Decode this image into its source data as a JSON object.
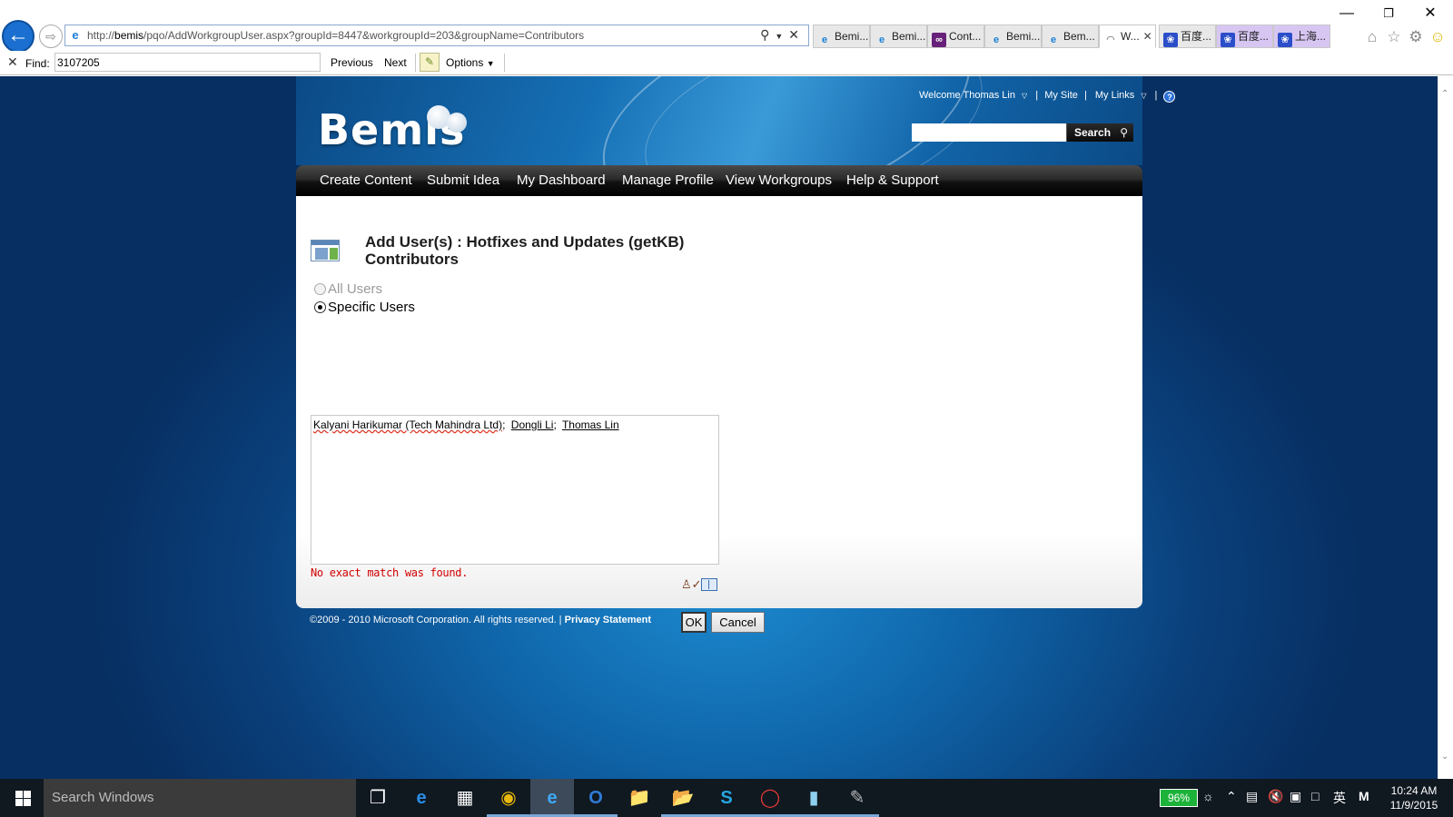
{
  "browser": {
    "url_prefix": "http://",
    "url_host": "bemis",
    "url_path": "/pqo/AddWorkgroupUser.aspx?groupId=8447&workgroupId=203&groupName=Contributors",
    "tabs": [
      {
        "label": "Bemi...",
        "icon": "ie-icon"
      },
      {
        "label": "Bemi...",
        "icon": "ie-icon"
      },
      {
        "label": "Cont...",
        "icon": "visual-studio-icon"
      },
      {
        "label": "Bemi...",
        "icon": "ie-icon"
      },
      {
        "label": "Bem...",
        "icon": "ie-icon"
      },
      {
        "label": "W...",
        "icon": "loading-icon",
        "active": true
      },
      {
        "label": "百度...",
        "icon": "baidu-icon"
      },
      {
        "label": "百度...",
        "icon": "baidu-icon"
      },
      {
        "label": "上海...",
        "icon": "baidu-icon"
      }
    ],
    "find": {
      "label": "Find:",
      "value": "3107205",
      "previous": "Previous",
      "next": "Next",
      "options": "Options"
    }
  },
  "site": {
    "logo": "Bemis",
    "welcome": "Welcome Thomas Lin",
    "my_site": "My Site",
    "my_links": "My Links",
    "search_button": "Search",
    "nav": [
      "Create Content",
      "Submit Idea",
      "My Dashboard",
      "Manage Profile",
      "View Workgroups",
      "Help & Support"
    ]
  },
  "form": {
    "title_line1": "Add User(s) : Hotfixes and Updates (getKB)",
    "title_line2": "Contributors",
    "radio_all": "All Users",
    "radio_specific": "Specific Users",
    "users": [
      "Kalyani Harikumar (Tech Mahindra Ltd)",
      "Dongli Li",
      "Thomas Lin"
    ],
    "separator": ";",
    "error": "No exact match was found.",
    "ok": "OK",
    "cancel": "Cancel"
  },
  "footer": {
    "copyright": "©2009 - 2010 Microsoft Corporation. All rights reserved. |",
    "privacy": "Privacy Statement"
  },
  "taskbar": {
    "search_placeholder": "Search Windows",
    "battery": "96%",
    "ime": "英",
    "time": "10:24 AM",
    "date": "11/9/2015"
  },
  "colors": {
    "error": "#d40000",
    "nav_bg": "#111111",
    "page_bg": "#0f64a8",
    "battery": "#1db33a"
  }
}
